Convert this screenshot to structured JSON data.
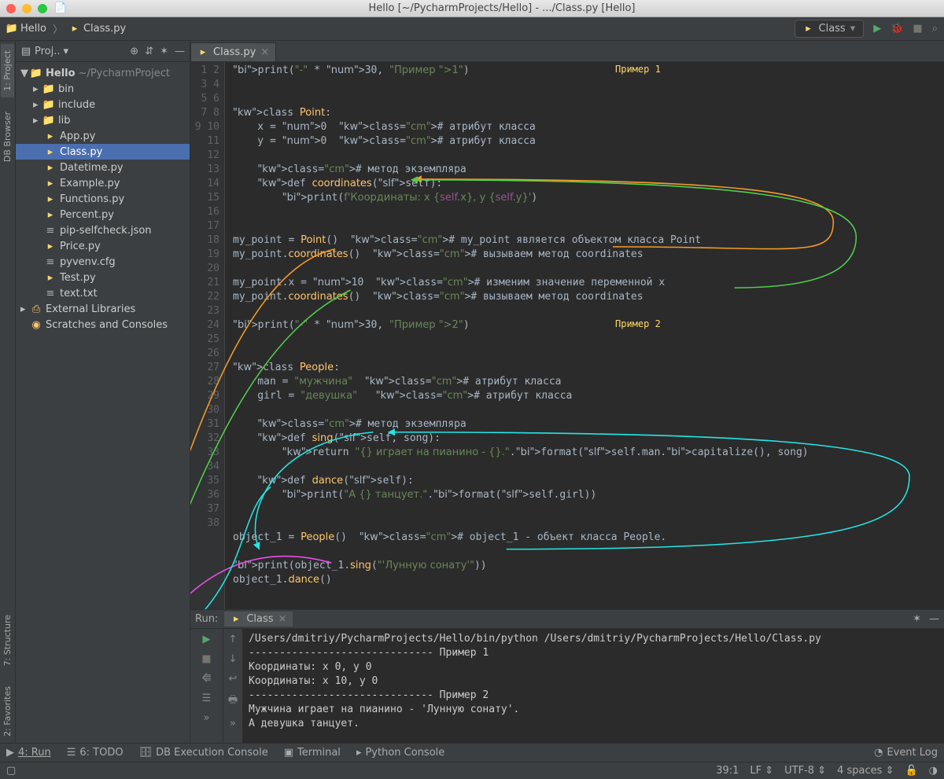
{
  "window_title": "Hello [~/PycharmProjects/Hello] - .../Class.py [Hello]",
  "breadcrumb": {
    "project": "Hello",
    "file": "Class.py"
  },
  "run_config": "Class",
  "left_tabs": [
    "1: Project",
    "DB Browser"
  ],
  "left_tabs_bottom": [
    "7: Structure",
    "2: Favorites"
  ],
  "project_panel": {
    "title": "Proj..",
    "root_name": "Hello",
    "root_path": "~/PycharmProject",
    "folders": [
      "bin",
      "include",
      "lib"
    ],
    "files": [
      "App.py",
      "Class.py",
      "Datetime.py",
      "Example.py",
      "Functions.py",
      "Percent.py",
      "pip-selfcheck.json",
      "Price.py",
      "pyvenv.cfg",
      "Test.py",
      "text.txt"
    ],
    "selected": "Class.py",
    "extras": [
      "External Libraries",
      "Scratches and Consoles"
    ]
  },
  "editor": {
    "tab": "Class.py",
    "annot1": "Пример 1",
    "annot2": "Пример 2",
    "lines": 38,
    "code": [
      "print(\"-\" * 30, \"Пример 1\")",
      "",
      "",
      "class Point:",
      "    x = 0  # атрибут класса",
      "    y = 0  # атрибут класса",
      "",
      "    # метод экземпляра",
      "    def coordinates(self):",
      "        print(f'Координаты: x {self.x}, y {self.y}')",
      "",
      "",
      "my_point = Point()  # my_point является объектом класса Point",
      "my_point.coordinates()  # вызываем метод coordinates",
      "",
      "my_point.x = 10  # изменим значение переменной x",
      "my_point.coordinates()  # вызываем метод coordinates",
      "",
      "print(\"-\" * 30, \"Пример 2\")",
      "",
      "",
      "class People:",
      "    man = \"мужчина\"  # атрибут класса",
      "    girl = \"девушка\"   # атрибут класса",
      "",
      "    # метод экземпляра",
      "    def sing(self, song):",
      "        return \"{} играет на пианино - {}.\".format(self.man.capitalize(), song)",
      "",
      "    def dance(self):",
      "        print(\"А {} танцует.\".format(self.girl))",
      "",
      "",
      "object_1 = People()  # object_1 - объект класса People.",
      "",
      "print(object_1.sing(\"'Лунную сонату'\"))",
      "object_1.dance()",
      ""
    ]
  },
  "run_panel": {
    "label": "Run:",
    "tab": "Class",
    "output": [
      "/Users/dmitriy/PycharmProjects/Hello/bin/python /Users/dmitriy/PycharmProjects/Hello/Class.py",
      "------------------------------ Пример 1",
      "Координаты: x 0, y 0",
      "Координаты: x 10, y 0",
      "------------------------------ Пример 2",
      "Мужчина играет на пианино - 'Лунную сонату'.",
      "А девушка танцует."
    ]
  },
  "bottom_tools": {
    "run": "4: Run",
    "todo": "6: TODO",
    "db": "DB Execution Console",
    "terminal": "Terminal",
    "py": "Python Console",
    "event": "Event Log"
  },
  "statusbar": {
    "pos": "39:1",
    "lf": "LF",
    "enc": "UTF-8",
    "indent": "4 spaces"
  }
}
